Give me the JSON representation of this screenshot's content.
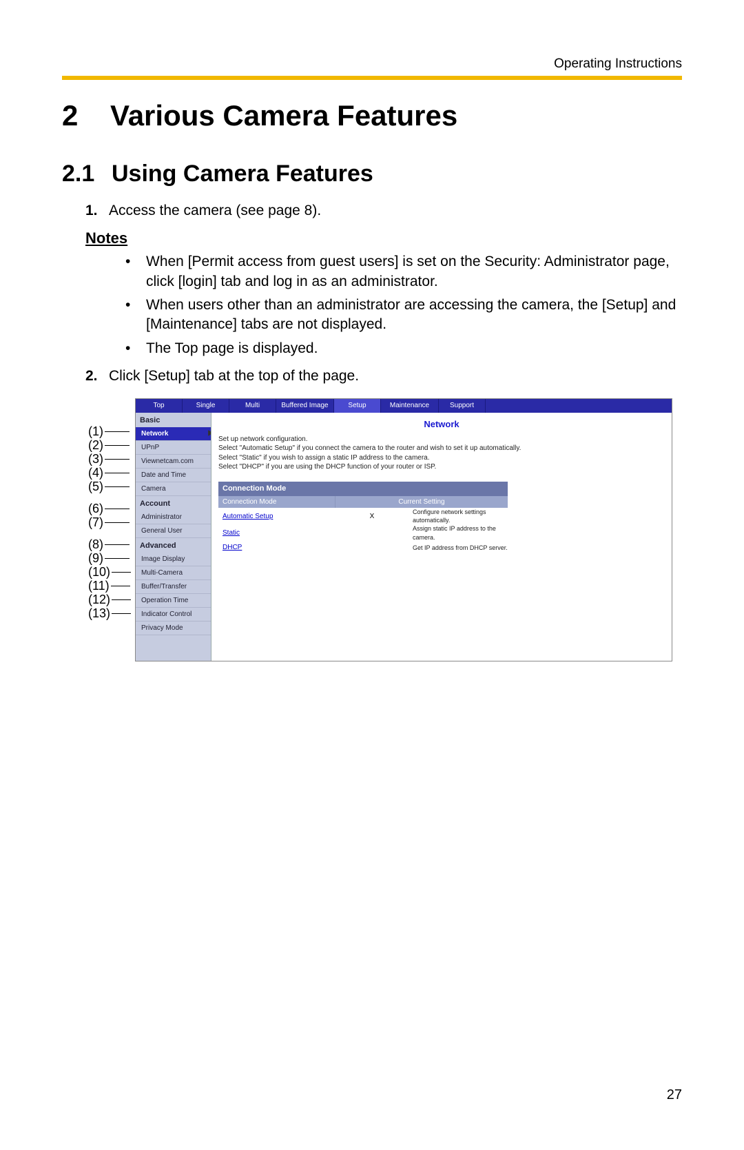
{
  "header": {
    "doc_label": "Operating Instructions"
  },
  "h1": {
    "num": "2",
    "title": "Various Camera Features"
  },
  "h2": {
    "num": "2.1",
    "title": "Using Camera Features"
  },
  "steps": {
    "s1": {
      "num": "1.",
      "text": "Access the camera (see page 8)."
    },
    "s2": {
      "num": "2.",
      "text": "Click [Setup] tab at the top of the page."
    }
  },
  "notes_heading": "Notes",
  "notes": {
    "n1": "When [Permit access from guest users] is set on the Security: Administrator page, click [login] tab and log in as an administrator.",
    "n2": "When users other than an administrator are accessing the camera, the [Setup] and [Maintenance] tabs are not displayed.",
    "n3": "The Top page is displayed."
  },
  "callouts": {
    "c1": "(1)",
    "c2": "(2)",
    "c3": "(3)",
    "c4": "(4)",
    "c5": "(5)",
    "c6": "(6)",
    "c7": "(7)",
    "c8": "(8)",
    "c9": "(9)",
    "c10": "(10)",
    "c11": "(11)",
    "c12": "(12)",
    "c13": "(13)"
  },
  "ui": {
    "tabs": {
      "top": "Top",
      "single": "Single",
      "multi": "Multi",
      "buffered": "Buffered Image",
      "setup": "Setup",
      "maintenance": "Maintenance",
      "support": "Support"
    },
    "sidebar": {
      "basic": "Basic",
      "items_basic": {
        "network": "Network",
        "upnp": "UPnP",
        "viewnetcam": "Viewnetcam.com",
        "datetime": "Date and Time",
        "camera": "Camera"
      },
      "account": "Account",
      "items_account": {
        "admin": "Administrator",
        "general": "General User"
      },
      "advanced": "Advanced",
      "items_advanced": {
        "imagedisplay": "Image Display",
        "multicamera": "Multi-Camera",
        "buffer": "Buffer/Transfer",
        "optime": "Operation Time",
        "indicator": "Indicator Control",
        "privacy": "Privacy Mode"
      }
    },
    "content": {
      "title": "Network",
      "desc1": "Set up network configuration.",
      "desc2": "Select \"Automatic Setup\" if you connect the camera to the router and wish to set it up automatically.",
      "desc3": "Select \"Static\" if you wish to assign a static IP address to the camera.",
      "desc4": "Select \"DHCP\" if you are using the DHCP function of your router or ISP.",
      "panel_head": "Connection Mode",
      "col1": "Connection Mode",
      "col2": "Current Setting",
      "rows": {
        "r1": {
          "name": "Automatic Setup",
          "cur": "X",
          "desc": "Configure network settings automatically."
        },
        "r2": {
          "name": "Static",
          "cur": "",
          "desc": "Assign static IP address to the camera."
        },
        "r3": {
          "name": "DHCP",
          "cur": "",
          "desc": "Get IP address from DHCP server."
        }
      }
    }
  },
  "page_number": "27"
}
